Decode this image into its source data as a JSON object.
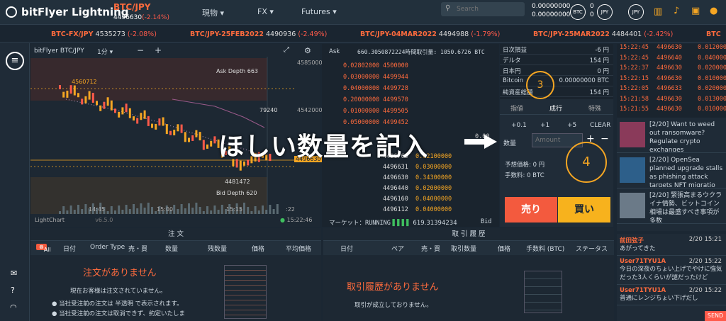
{
  "header": {
    "logo": "bitFlyer Lightning",
    "pair": "BTC/JPY",
    "price": "4496630",
    "change": "(-2.14%)",
    "menus": [
      "現物",
      "FX",
      "Futures"
    ],
    "search_placeholder": "Search",
    "bal_btc": "0.00000000",
    "bal_btc2": "0.00000000",
    "bal_jpy": "0",
    "bal_jpy2": "0",
    "btc_badge": "BTC",
    "jpy_badge": "JPY",
    "jpy_badge2": "JPY"
  },
  "ticker": [
    {
      "pair": "BTC-FX/JPY",
      "price": "4535273",
      "change": "(-2.08%)"
    },
    {
      "pair": "BTC/JPY-25FEB2022",
      "price": "4490936",
      "change": "(-2.49%)"
    },
    {
      "pair": "BTC/JPY-04MAR2022",
      "price": "4494988",
      "change": "(-1.79%)"
    },
    {
      "pair": "BTC/JPY-25MAR2022",
      "price": "4484401",
      "change": "(-2.42%)"
    },
    {
      "pair": "BTC"
    }
  ],
  "chart": {
    "title": "bitFlyer BTC/JPY",
    "interval": "1分",
    "ask_depth": "Ask Depth 663",
    "bid_depth": "Bid Depth 620",
    "high_label": "4560712",
    "low_label": "4481472",
    "mid_label": "79240",
    "current": "4496630",
    "y_ticks": [
      "4585000",
      "4542000",
      "4496630"
    ],
    "x_ticks": [
      "14:45",
      "15:00",
      "15:15",
      ":22"
    ],
    "footer": "LightChart",
    "version": "v6.5.0",
    "time": "15:22:46"
  },
  "orderbook": {
    "ask_label": "Ask",
    "header": "660.3050872224時間取引量: 1050.6726 BTC",
    "asks": [
      [
        "0.02802000",
        "4500000"
      ],
      [
        "0.03000000",
        "4499944"
      ],
      [
        "0.04000000",
        "4499728"
      ],
      [
        "0.20000000",
        "4499570"
      ],
      [
        "0.01000000",
        "4499505"
      ],
      [
        "0.05000000",
        "4499452"
      ]
    ],
    "bids": [
      [
        "4496760",
        "0.02100000"
      ],
      [
        "4496631",
        "0.03000000"
      ],
      [
        "4496630",
        "0.34300000"
      ],
      [
        "4496440",
        "0.02000000"
      ],
      [
        "4496160",
        "0.04000000"
      ],
      [
        "4496112",
        "0.04000000"
      ]
    ],
    "market_label": "マーケット：",
    "market_status": "RUNNING",
    "market_val": "619.31394234",
    "bid_label": "Bid",
    "partial_val": "0.00"
  },
  "stats": [
    [
      "日次損益",
      "-6 円"
    ],
    [
      "デルタ",
      "154 円"
    ],
    [
      "日本円",
      "0 円"
    ],
    [
      "Bitcoin",
      "0.00000000 BTC"
    ],
    [
      "純資産総額",
      "154 円"
    ]
  ],
  "panel": {
    "tabs": [
      "指値",
      "成行",
      "特殊"
    ],
    "steps": [
      "+0.1",
      "+1",
      "+5",
      "CLEAR"
    ],
    "qty_label": "数量",
    "qty_placeholder": "Amount",
    "est_label": "予想価格: 0 円",
    "fee_label": "手数料: 0 BTC",
    "sell": "売り",
    "buy": "買い",
    "circle3": "3",
    "circle4": "4"
  },
  "overlay": {
    "caption": "ほしい数量を記入"
  },
  "trades": [
    [
      "15:22:45",
      "4496630",
      "0.012000"
    ],
    [
      "15:22:45",
      "4496640",
      "0.040000"
    ],
    [
      "15:22:37",
      "4496630",
      "0.020000"
    ],
    [
      "15:22:15",
      "4496630",
      "0.010000"
    ],
    [
      "15:22:05",
      "4496633",
      "0.020000"
    ],
    [
      "15:21:58",
      "4496630",
      "0.013000"
    ],
    [
      "15:21:55",
      "4496630",
      "0.010000"
    ]
  ],
  "news": [
    {
      "text": "[2/20] Want to weed out ransomware? Regulate crypto exchanges",
      "color": "#8a3a5a"
    },
    {
      "text": "[2/20] OpenSea planned upgrade stalls as phishing attack targets NFT migratio",
      "color": "#2d5f8a"
    },
    {
      "text": "[2/20] 緊張高まるウクライナ情勢、ビットコイン相場は最盛すべき事項が多数",
      "color": "#6b7a88"
    }
  ],
  "chat": [
    {
      "user": "前田弦子",
      "time": "2/20 15:21",
      "msg": "あがってきた"
    },
    {
      "user": "User71TYU1A",
      "time": "2/20 15:22",
      "msg": "今日の深夜のちょい上げでやけに強気だった3人くらいが謎だったけど"
    },
    {
      "user": "User71TYU1A",
      "time": "2/20 15:22",
      "msg": "普通にレンジちょい下げだし"
    }
  ],
  "chat_send": "SEND",
  "orders": {
    "title": "注 文",
    "all": "All",
    "cols": [
      "日付",
      "Order Type",
      "売・買",
      "数量",
      "残数量",
      "価格",
      "平均価格"
    ],
    "empty": "注文がありません",
    "msg1": "現在お客様は注文されていません。",
    "note1": "当社受注前の注文は 半透明 で表示されます。",
    "note2": "当社受注前の注文は取消できず、約定いたしま"
  },
  "history": {
    "title": "取 引 履 歴",
    "cols": [
      "日付",
      "ペア",
      "売・買",
      "取引数量",
      "価格",
      "手数料 (BTC)",
      "ステータス"
    ],
    "empty": "取引履歴がありません",
    "msg1": "取引が成立しておりません。"
  },
  "colors": {
    "accent": "#f5a623",
    "red": "#ff5a4a",
    "green": "#3fbf5f",
    "sell": "#f35a3e",
    "buy": "#f7b21d"
  }
}
